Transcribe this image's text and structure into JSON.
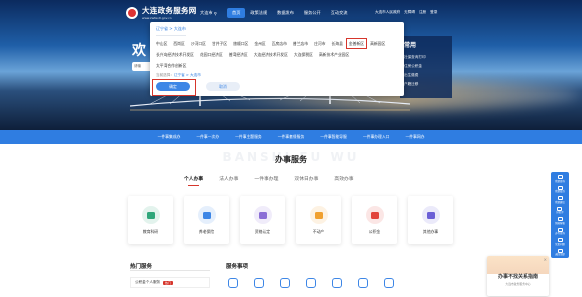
{
  "header": {
    "site_name": "大连政务服务网",
    "site_url": "www.zwfw.dl.gov.cn",
    "city": "大连市",
    "nav": [
      "首页",
      "政策法规",
      "数据发布",
      "服务公开",
      "互动交流"
    ],
    "top_links": [
      "大连市人民政府",
      "无障碍",
      "注册",
      "登录"
    ]
  },
  "hero": {
    "title": "欢",
    "search_placeholder": "请输",
    "common_title": "常用",
    "common_items": [
      "社保查询打印",
      "住房公积金",
      "出生缴费",
      "户籍迁移"
    ]
  },
  "location_popup": {
    "current": "辽宁省 > 大连市",
    "districts_row1": [
      "中山区",
      "西岗区",
      "沙河口区",
      "甘井子区",
      "旅顺口区",
      "金州区",
      "瓦房店市",
      "普兰店市",
      "庄河市",
      "长海县",
      "金普新区",
      "高新园区"
    ],
    "districts_row2": [
      "长兴岛经济技术开发区",
      "花园口经济区",
      "普湾经济区",
      "大连经济技术开发区",
      "大连保税区",
      "高新技术产业园区"
    ],
    "districts_row3": [
      "太平湾合作创新区"
    ],
    "selected": "金普新区",
    "breadcrumb_label": "当前选择：",
    "breadcrumb_path": "辽宁省 > 大连市",
    "ok_label": "确定",
    "cancel_label": "取消"
  },
  "quick_bar": [
    "一件事集成办",
    "一件事一次办",
    "一件事主题服务",
    "一件事套餐服务",
    "一件事智能导服",
    "一件事办理入口",
    "一件事网办"
  ],
  "services": {
    "bg_text": "BANSHI FU WU",
    "title": "办事服务",
    "tabs": [
      "个人办事",
      "法人办事",
      "一件事办理",
      "双休日办事",
      "高效办事"
    ],
    "active_tab": "个人办事",
    "cards": [
      {
        "label": "教育科研",
        "color": "#2fa67a",
        "icon": "graduation-icon"
      },
      {
        "label": "养老保险",
        "color": "#3d86e6",
        "icon": "elder-icon"
      },
      {
        "label": "资格认定",
        "color": "#8b6fd6",
        "icon": "certificate-icon"
      },
      {
        "label": "不动产",
        "color": "#f0a030",
        "icon": "house-icon"
      },
      {
        "label": "公积金",
        "color": "#e2453c",
        "icon": "fund-icon"
      },
      {
        "label": "其他办事",
        "color": "#6b5fd6",
        "icon": "more-icon"
      }
    ]
  },
  "hot": {
    "title": "热门服务",
    "item_text": "公积金个人服务",
    "item_badge": "热门"
  },
  "items": {
    "title": "服务事项"
  },
  "side_tools": [
    {
      "label": "我要咨询",
      "icon": "chat-icon"
    },
    {
      "label": "我要投诉",
      "icon": "complaint-icon"
    },
    {
      "label": "我要建议",
      "icon": "suggest-icon"
    },
    {
      "label": "好差评",
      "icon": "rating-icon"
    },
    {
      "label": "智能客服",
      "icon": "bot-icon"
    },
    {
      "label": "办件查询",
      "icon": "search-icon"
    },
    {
      "label": "常见问题",
      "icon": "faq-icon"
    },
    {
      "label": "返回顶部",
      "icon": "top-icon"
    }
  ],
  "promo": {
    "title": "办事不找关系指南",
    "subtitle": "大连市政务服务中心"
  }
}
